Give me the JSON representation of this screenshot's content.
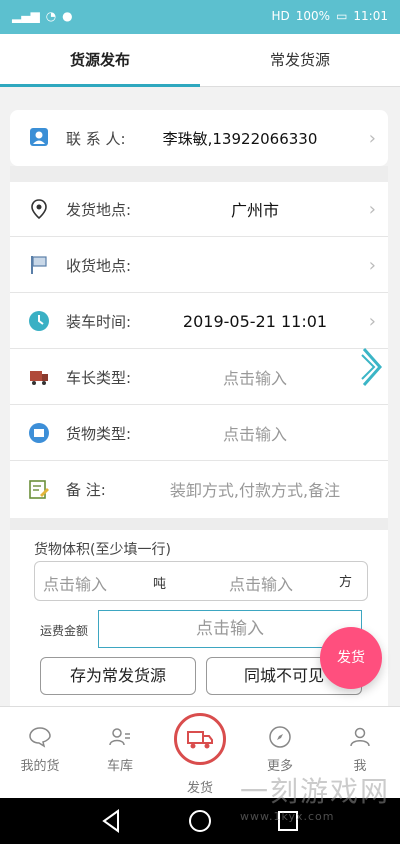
{
  "status": {
    "hd": "HD",
    "battery": "100%",
    "time": "11:01"
  },
  "tabs": [
    {
      "label": "货源发布"
    },
    {
      "label": "常发货源"
    }
  ],
  "contact": {
    "label": "联 系 人:",
    "value": "李珠敏,13922066330"
  },
  "rows": [
    {
      "label": "发货地点:",
      "value": "广州市",
      "icon": "location-pin-icon"
    },
    {
      "label": "收货地点:",
      "value": "",
      "icon": "flag-icon"
    },
    {
      "label": "装车时间:",
      "value": "2019-05-21 11:01",
      "icon": "clock-icon"
    },
    {
      "label": "车长类型:",
      "placeholder": "点击输入",
      "icon": "truck-icon"
    },
    {
      "label": "货物类型:",
      "placeholder": "点击输入",
      "icon": "cargo-box-icon"
    },
    {
      "label": "备    注:",
      "placeholder": "装卸方式,付款方式,备注",
      "icon": "note-edit-icon"
    }
  ],
  "volume": {
    "title": "货物体积(至少填一行)",
    "weight_placeholder": "点击输入",
    "weight_unit": "吨",
    "cubic_placeholder": "点击输入",
    "cubic_unit": "方"
  },
  "fee": {
    "label": "运费金额",
    "placeholder": "点击输入"
  },
  "buttons": {
    "frequent": "存为常发货源",
    "same_city": "同城不可见"
  },
  "fab": {
    "label": "发货"
  },
  "tabbar": [
    {
      "label": "我的货",
      "icon": "chat-bubble-icon"
    },
    {
      "label": "车库",
      "icon": "driver-list-icon"
    },
    {
      "label": "发货",
      "icon": "delivery-truck-icon"
    },
    {
      "label": "更多",
      "icon": "compass-icon"
    },
    {
      "label": "我",
      "icon": "person-icon"
    }
  ],
  "watermark": {
    "text": "一刻游戏网",
    "url": "www.1kyx.com"
  },
  "colors": {
    "accent": "#5cc0cf",
    "fab": "#ff4f7e",
    "active_tab_line": "#2fa8bf"
  }
}
